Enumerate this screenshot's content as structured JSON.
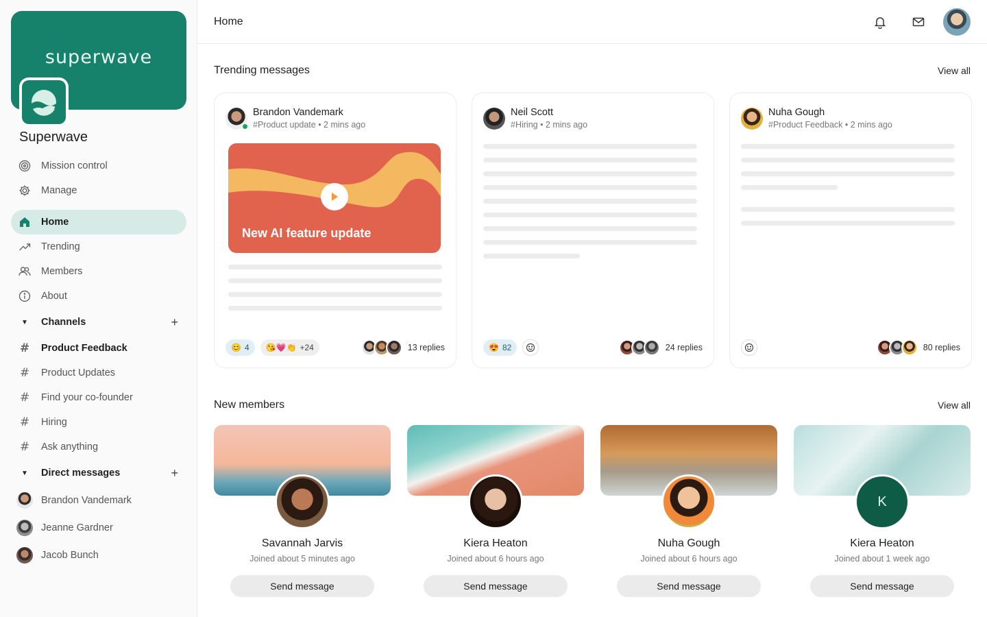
{
  "brand": {
    "wordmark": "superwave",
    "name": "Superwave"
  },
  "sidebar": {
    "top_items": [
      {
        "label": "Mission control",
        "icon": "target-icon"
      },
      {
        "label": "Manage",
        "icon": "gear-icon"
      }
    ],
    "nav_items": [
      {
        "label": "Home",
        "icon": "home-icon",
        "active": true
      },
      {
        "label": "Trending",
        "icon": "trending-icon"
      },
      {
        "label": "Members",
        "icon": "members-icon"
      },
      {
        "label": "About",
        "icon": "info-icon"
      }
    ],
    "channels_heading": "Channels",
    "channels": [
      {
        "label": "Product Feedback",
        "bold": true
      },
      {
        "label": "Product Updates"
      },
      {
        "label": "Find your co-founder"
      },
      {
        "label": "Hiring"
      },
      {
        "label": "Ask anything"
      }
    ],
    "dm_heading": "Direct messages",
    "dms": [
      {
        "label": "Brandon Vandemark"
      },
      {
        "label": "Jeanne Gardner"
      },
      {
        "label": "Jacob Bunch"
      }
    ]
  },
  "topbar": {
    "title": "Home"
  },
  "trending": {
    "heading": "Trending messages",
    "view_all": "View all",
    "cards": [
      {
        "author": "Brandon Vandemark",
        "meta": "#Product update • 2 mins ago",
        "promo_title": "New AI feature update",
        "reaction1_count": "4",
        "reaction2_count": "+24",
        "replies": "13 replies"
      },
      {
        "author": "Neil Scott",
        "meta": "#Hiring • 2 mins ago",
        "reaction1_count": "82",
        "replies": "24 replies"
      },
      {
        "author": "Nuha Gough",
        "meta": "#Product Feedback • 2 mins ago",
        "replies": "80 replies"
      }
    ]
  },
  "members": {
    "heading": "New members",
    "view_all": "View all",
    "list": [
      {
        "name": "Savannah Jarvis",
        "joined": "Joined about 5 minutes ago",
        "button": "Send message"
      },
      {
        "name": "Kiera Heaton",
        "joined": "Joined about 6 hours ago",
        "button": "Send message"
      },
      {
        "name": "Nuha Gough",
        "joined": "Joined about 6 hours ago",
        "button": "Send message"
      },
      {
        "name": "Kiera Heaton",
        "joined": "Joined about 1 week ago",
        "button": "Send message",
        "initial": "K"
      }
    ]
  },
  "colors": {
    "brand": "#16826b",
    "active_bg": "#d7ebe6",
    "promo": "#e1634e",
    "promo_wave": "#f4b860"
  }
}
